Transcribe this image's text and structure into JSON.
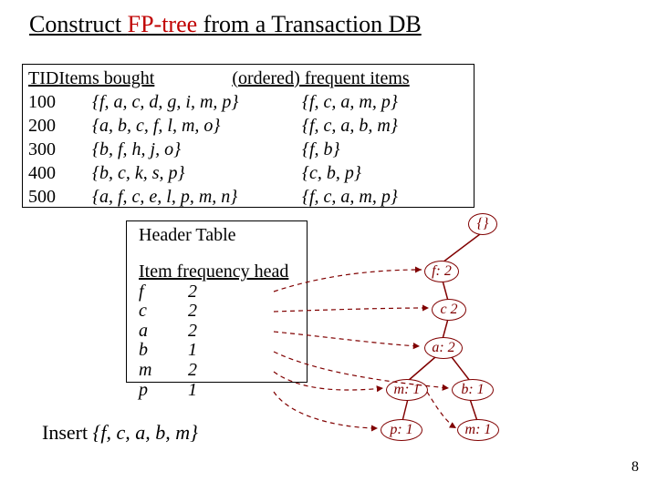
{
  "title": {
    "prefix": "Construct ",
    "red": "FP-tree",
    "suffix": " from a Transaction DB"
  },
  "table": {
    "headers": {
      "tid": "TID",
      "items": "Items bought",
      "freq": "(ordered) frequent items"
    },
    "rows": [
      {
        "tid": "100",
        "items": "{f, a, c, d, g, i, m, p}",
        "freq": "{f, c, a, m, p}"
      },
      {
        "tid": "200",
        "items": "{a, b, c, f, l, m, o}",
        "freq": "{f, c, a, b, m}"
      },
      {
        "tid": "300",
        "items": "{b, f, h, j, o}",
        "freq": "{f, b}"
      },
      {
        "tid": "400",
        "items": "{b, c, k, s, p}",
        "freq": "{c, b, p}"
      },
      {
        "tid": "500",
        "items": "{a, f, c, e, l, p, m, n}",
        "freq": "{f, c, a, m, p}"
      }
    ]
  },
  "headerTable": {
    "label": "Header Table",
    "columns": "Item  frequency  head",
    "rows": [
      {
        "it": "f",
        "fr": "2"
      },
      {
        "it": "c",
        "fr": "2"
      },
      {
        "it": "a",
        "fr": "2"
      },
      {
        "it": "b",
        "fr": "1"
      },
      {
        "it": "m",
        "fr": "2"
      },
      {
        "it": "p",
        "fr": "1"
      }
    ]
  },
  "tree": {
    "root": "{}",
    "nodes": {
      "f": "f: 2",
      "c": "c 2",
      "a": "a: 2",
      "m1": "m: 1",
      "b1": "b: 1",
      "p1": "p: 1",
      "m2": "m: 1"
    }
  },
  "insert": {
    "prefix": "Insert ",
    "set": "{f, c, a, b, m}"
  },
  "pageNumber": "8"
}
